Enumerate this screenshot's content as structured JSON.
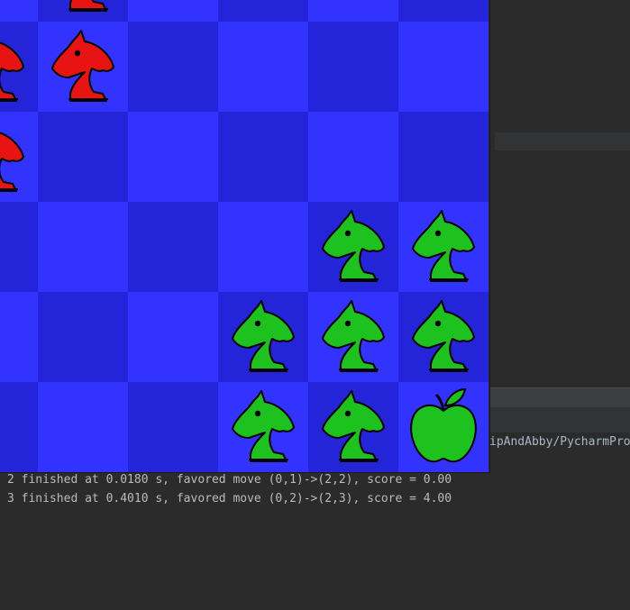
{
  "colors": {
    "board_light": "#3333ff",
    "board_dark": "#2424d8",
    "red_piece": "#e81414",
    "green_piece": "#1ec21e",
    "console_text": "#bbbbbb"
  },
  "ide": {
    "path_fragment": "ipAndAbby/PycharmPro"
  },
  "console": {
    "lines": [
      "2 finished at 0.0180 s, favored move (0,1)->(2,2), score = 0.00",
      "3 finished at 0.4010 s, favored move (0,2)->(2,3), score = 4.00"
    ]
  },
  "board": {
    "pieces": [
      {
        "type": "knight-icon",
        "color": "red",
        "row": 0,
        "col": 1
      },
      {
        "type": "knight-icon",
        "color": "red",
        "row": 1,
        "col": 0
      },
      {
        "type": "knight-icon",
        "color": "red",
        "row": 1,
        "col": 1
      },
      {
        "type": "knight-icon",
        "color": "red",
        "row": 2,
        "col": 0
      },
      {
        "type": "knight-icon",
        "color": "green",
        "row": 3,
        "col": 4
      },
      {
        "type": "knight-icon",
        "color": "green",
        "row": 3,
        "col": 5
      },
      {
        "type": "knight-icon",
        "color": "green",
        "row": 4,
        "col": 3
      },
      {
        "type": "knight-icon",
        "color": "green",
        "row": 4,
        "col": 4
      },
      {
        "type": "knight-icon",
        "color": "green",
        "row": 4,
        "col": 5
      },
      {
        "type": "knight-icon",
        "color": "green",
        "row": 5,
        "col": 3
      },
      {
        "type": "knight-icon",
        "color": "green",
        "row": 5,
        "col": 4
      },
      {
        "type": "apple-icon",
        "color": "green",
        "row": 5,
        "col": 5
      }
    ]
  }
}
